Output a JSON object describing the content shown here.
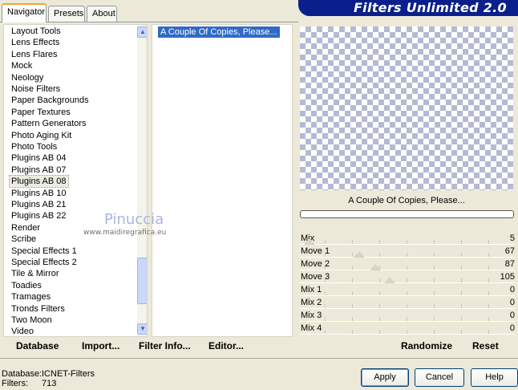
{
  "tabs": [
    {
      "label": "Navigator",
      "active": true
    },
    {
      "label": "Presets",
      "active": false
    },
    {
      "label": "About",
      "active": false
    }
  ],
  "header": {
    "title": "Filters Unlimited 2.0"
  },
  "categories": [
    "Layout Tools",
    "Lens Effects",
    "Lens Flares",
    "Mock",
    "Neology",
    "Noise Filters",
    "Paper Backgrounds",
    "Paper Textures",
    "Pattern Generators",
    "Photo Aging Kit",
    "Photo Tools",
    "Plugins AB 04",
    "Plugins AB 07",
    "Plugins AB 08",
    "Plugins AB 10",
    "Plugins AB 21",
    "Plugins AB 22",
    "Render",
    "Scribe",
    "Special Effects 1",
    "Special Effects 2",
    "Tile & Mirror",
    "Toadies",
    "Tramages",
    "Tronds Filters",
    "Two Moon",
    "Video"
  ],
  "selected_category": "Plugins AB 08",
  "filters": [
    "A Couple Of Copies, Please..."
  ],
  "preview": {
    "title": "A Couple Of Copies, Please..."
  },
  "params": [
    {
      "label": "Mix",
      "value": "5",
      "level": 0.02
    },
    {
      "label": "Move 1",
      "value": "67",
      "level": 0.26
    },
    {
      "label": "Move 2",
      "value": "87",
      "level": 0.34
    },
    {
      "label": "Move 3",
      "value": "105",
      "level": 0.41
    },
    {
      "label": "Mix 1",
      "value": "0",
      "level": 0
    },
    {
      "label": "Mix 2",
      "value": "0",
      "level": 0
    },
    {
      "label": "Mix 3",
      "value": "0",
      "level": 0
    },
    {
      "label": "Mix 4",
      "value": "0",
      "level": 0
    }
  ],
  "toolbar": {
    "database": "Database",
    "import": "Import...",
    "filter_info": "Filter Info...",
    "editor": "Editor...",
    "randomize": "Randomize",
    "reset": "Reset"
  },
  "status": {
    "database_label": "Database:",
    "database_value": "ICNET-Filters",
    "filters_label": "Filters:",
    "filters_value": "713"
  },
  "buttons": {
    "apply": "Apply",
    "cancel": "Cancel",
    "help": "Help"
  },
  "watermark": {
    "name": "Pinuccia",
    "site": "www.maidiregrafica.eu"
  },
  "colors": {
    "banner": "#0b1f8c",
    "selection": "#316ac5",
    "checker": "#b5bad3"
  }
}
